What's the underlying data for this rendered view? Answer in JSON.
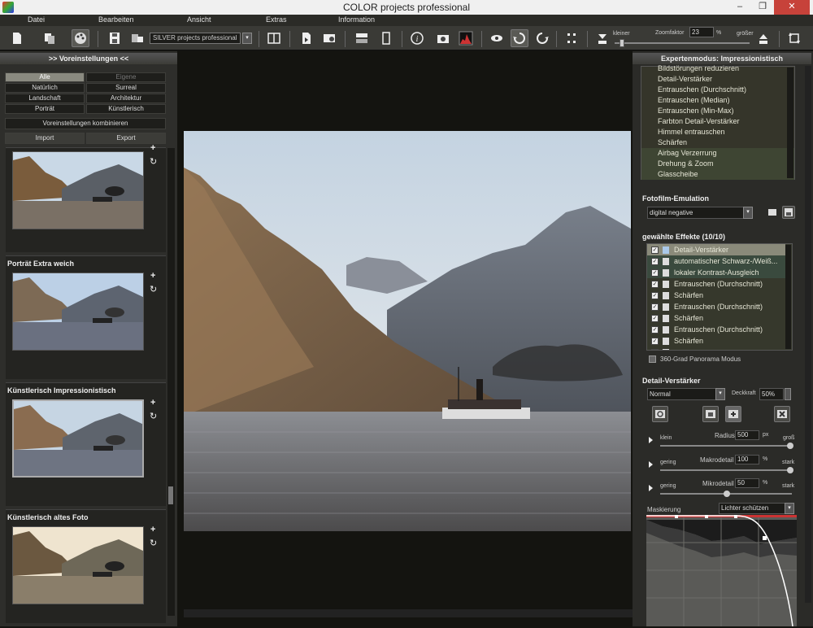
{
  "window": {
    "title": "COLOR projects professional",
    "minimize": "–",
    "maximize": "❐",
    "close": "✕"
  },
  "menu": [
    "Datei",
    "Bearbeiten",
    "Ansicht",
    "Extras",
    "Information"
  ],
  "toolbar": {
    "preset": "SILVER projects professional",
    "zoom_small": "kleiner",
    "zoom_label": "Zoomfaktor",
    "zoom_value": "23",
    "zoom_unit": "%",
    "zoom_large": "größer"
  },
  "left": {
    "header": ">> Voreinstellungen <<",
    "filters": [
      "Alle",
      "Eigene",
      "Natürlich",
      "Surreal",
      "Landschaft",
      "Architektur",
      "Porträt",
      "Künstlerisch"
    ],
    "combine": "Voreinstellungen kombinieren",
    "import": "Import",
    "export": "Export",
    "thumbs": [
      "",
      "Porträt Extra weich",
      "Künstlerisch Impressionistisch",
      "Künstlerisch altes Foto"
    ],
    "plus": "+",
    "refresh": "↻"
  },
  "right": {
    "header": "Expertenmodus: Impressionistisch",
    "effects_list": [
      "Bildstörungen reduzieren",
      "Detail-Verstärker",
      "Entrauschen (Durchschnitt)",
      "Entrauschen (Median)",
      "Entrauschen (Min-Max)",
      "Farbton Detail-Verstärker",
      "Himmel entrauschen",
      "Schärfen",
      "Airbag Verzerrung",
      "Drehung & Zoom",
      "Glasscheibe"
    ],
    "film_label": "Fotofilm-Emulation",
    "film_value": "digital negative",
    "selected_label": "gewählte Effekte (10/10)",
    "selected": [
      "Detail-Verstärker",
      "automatischer Schwarz-/Weiß...",
      "lokaler Kontrast-Ausgleich",
      "Entrauschen (Durchschnitt)",
      "Schärfen",
      "Entrauschen (Durchschnitt)",
      "Schärfen",
      "Entrauschen (Durchschnitt)",
      "Schärfen",
      "..."
    ],
    "check": "✓",
    "panorama": "360-Grad Panorama Modus",
    "detail_label": "Detail-Verstärker",
    "blend_mode": "Normal",
    "opacity_label": "Deckkraft",
    "opacity_value": "50%",
    "radius": {
      "min": "klein",
      "label": "Radius",
      "value": "500",
      "unit": "px",
      "max": "groß"
    },
    "macro": {
      "min": "gering",
      "label": "Makrodetail",
      "value": "100",
      "unit": "%",
      "max": "stark"
    },
    "micro": {
      "min": "gering",
      "label": "Mikrodetail",
      "value": "50",
      "unit": "%",
      "max": "stark"
    },
    "mask_label": "Maskierung",
    "mask_value": "Lichter schützen",
    "dropdown": "▾"
  }
}
